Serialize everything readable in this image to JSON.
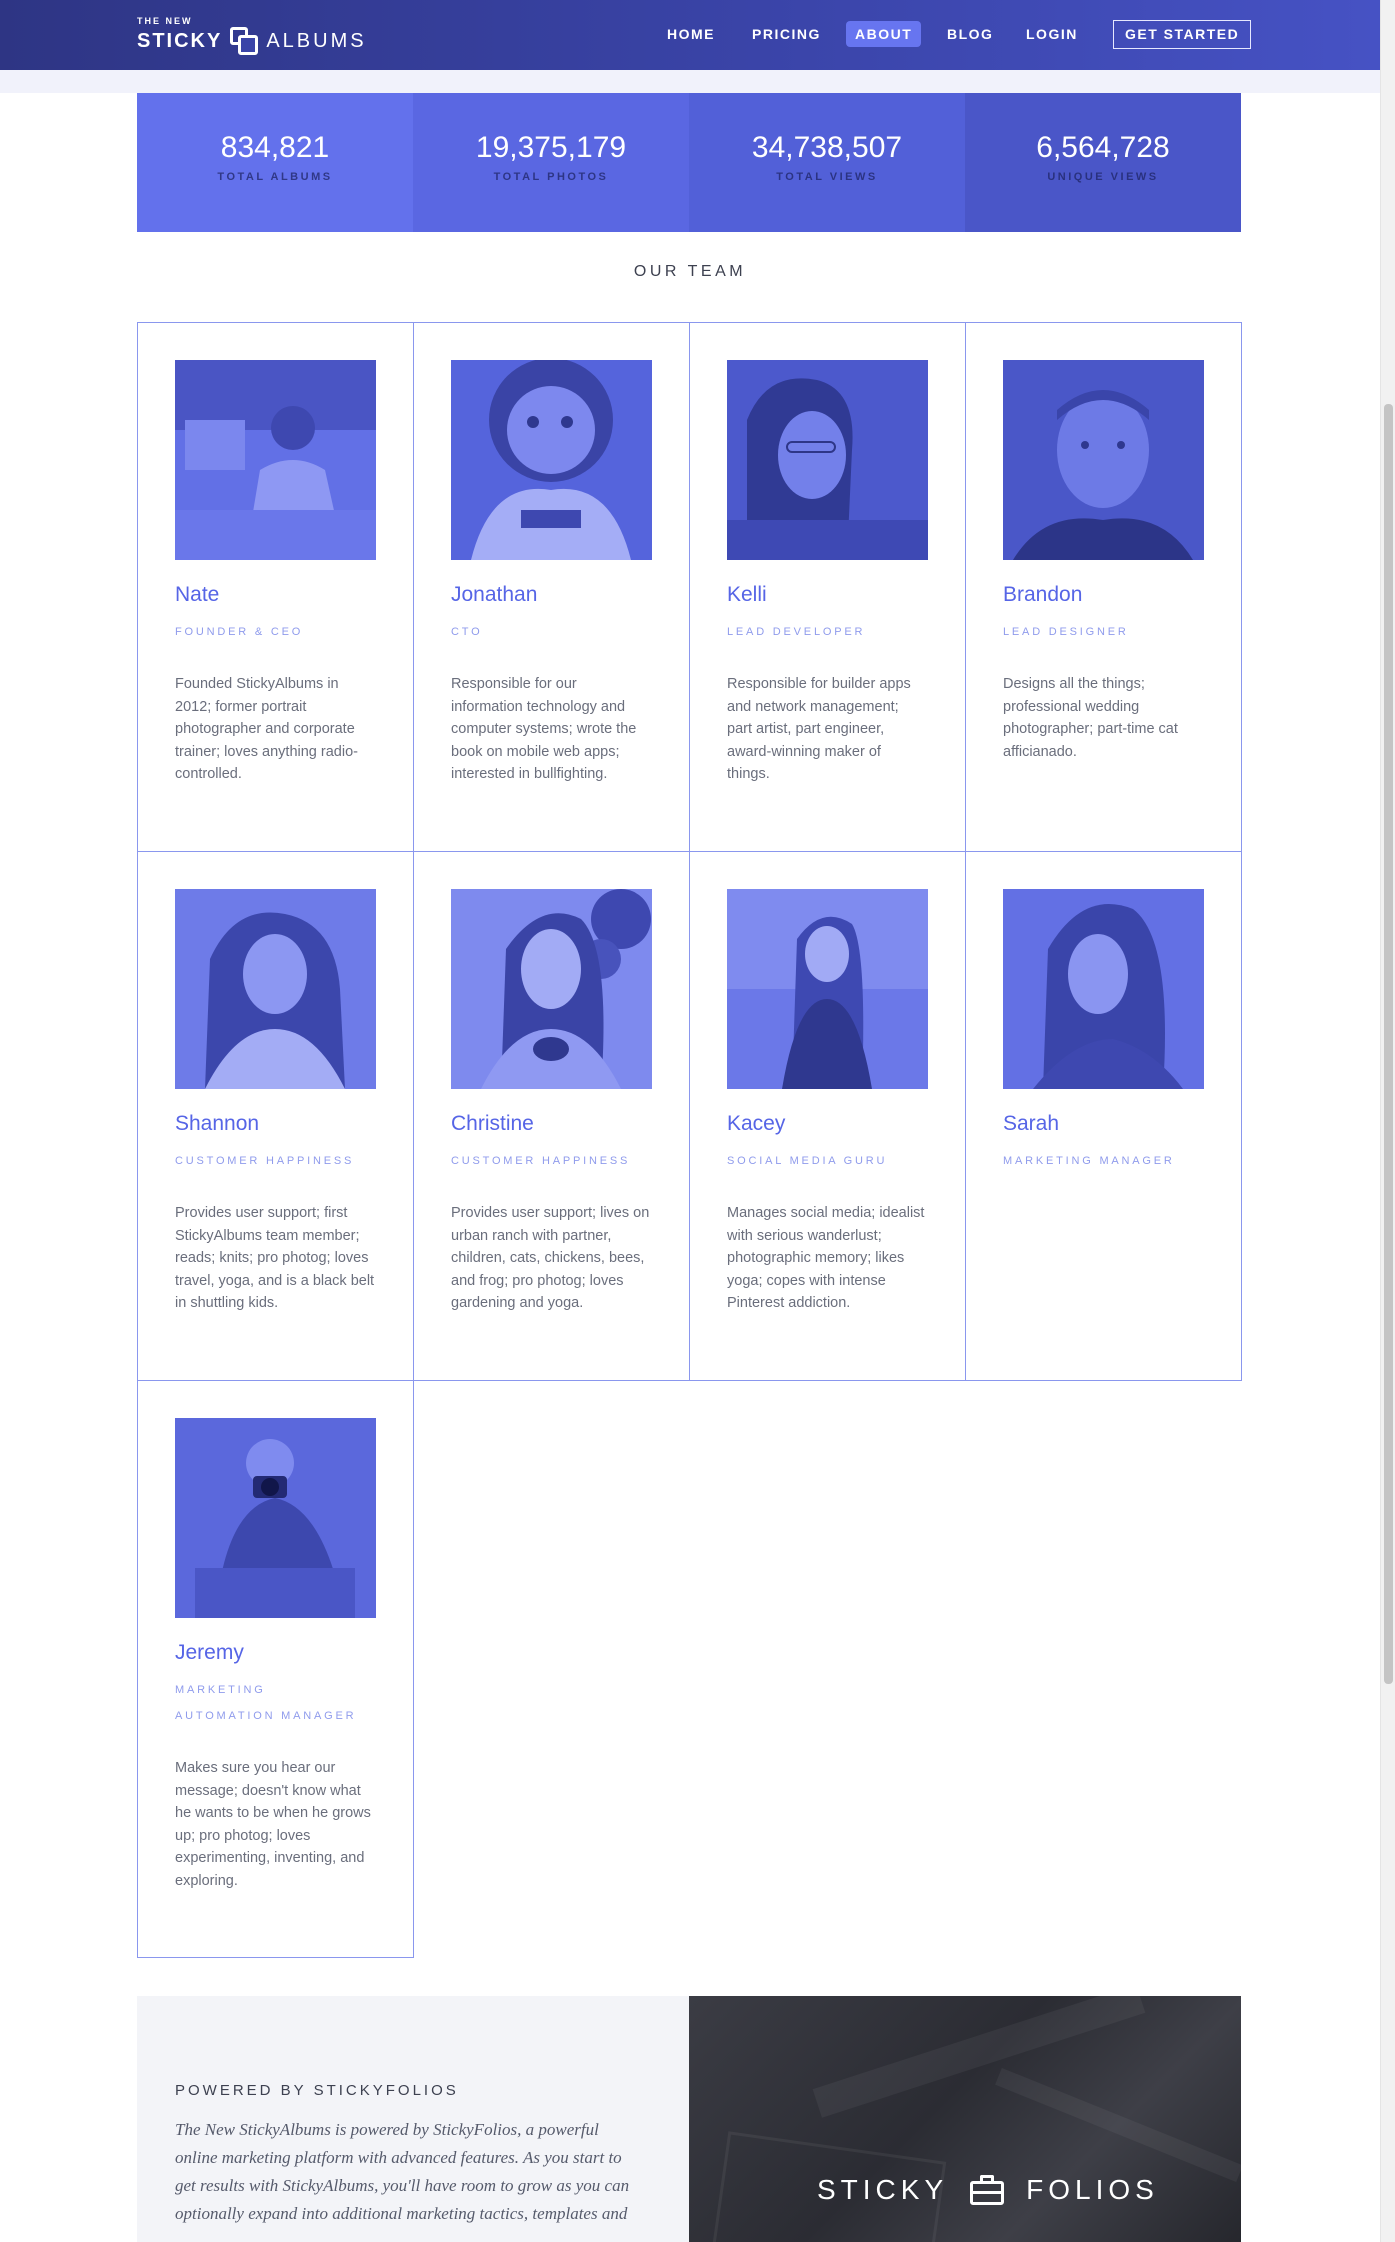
{
  "header": {
    "brand_small": "THE NEW",
    "brand_left": "STICKY",
    "brand_right": "ALBUMS",
    "nav": [
      {
        "label": "HOME",
        "active": false
      },
      {
        "label": "PRICING",
        "active": false
      },
      {
        "label": "ABOUT",
        "active": true
      },
      {
        "label": "BLOG",
        "active": false
      },
      {
        "label": "LOGIN",
        "active": false
      }
    ],
    "cta_label": "GET STARTED"
  },
  "stats": [
    {
      "value": "834,821",
      "label": "TOTAL ALBUMS"
    },
    {
      "value": "19,375,179",
      "label": "TOTAL PHOTOS"
    },
    {
      "value": "34,738,507",
      "label": "TOTAL VIEWS"
    },
    {
      "value": "6,564,728",
      "label": "UNIQUE VIEWS"
    }
  ],
  "team": {
    "title": "OUR TEAM",
    "members": [
      {
        "name": "Nate",
        "role": [
          "FOUNDER & CEO"
        ],
        "bio": [
          "Founded StickyAlbums in",
          "2012; former portrait",
          "photographer and corporate",
          "trainer; loves anything radio-",
          "controlled."
        ]
      },
      {
        "name": "Jonathan",
        "role": [
          "CTO"
        ],
        "bio": [
          "Responsible for our",
          "information technology and",
          "computer systems; wrote the",
          "book on mobile web apps;",
          "interested in bullfighting."
        ]
      },
      {
        "name": "Kelli",
        "role": [
          "LEAD DEVELOPER"
        ],
        "bio": [
          "Responsible for builder apps",
          "and network management;",
          "part artist, part engineer,",
          "award-winning maker of",
          "things."
        ]
      },
      {
        "name": "Brandon",
        "role": [
          "LEAD DESIGNER"
        ],
        "bio": [
          "Designs all the things;",
          "professional wedding",
          "photographer; part-time cat",
          "afficianado."
        ]
      },
      {
        "name": "Shannon",
        "role": [
          "CUSTOMER HAPPINESS"
        ],
        "bio": [
          "Provides user support; first",
          "StickyAlbums team member;",
          "reads; knits; pro photog; loves",
          "travel, yoga, and is a black belt",
          "in shuttling kids."
        ]
      },
      {
        "name": "Christine",
        "role": [
          "CUSTOMER HAPPINESS"
        ],
        "bio": [
          "Provides user support; lives on",
          "urban ranch with partner,",
          "children, cats, chickens, bees,",
          "and frog; pro photog; loves",
          "gardening and yoga."
        ]
      },
      {
        "name": "Kacey",
        "role": [
          "SOCIAL MEDIA GURU"
        ],
        "bio": [
          "Manages social media; idealist",
          "with serious wanderlust;",
          "photographic memory; likes",
          "yoga; copes with intense",
          "Pinterest addiction."
        ]
      },
      {
        "name": "Sarah",
        "role": [
          "MARKETING MANAGER"
        ],
        "bio": []
      },
      {
        "name": "Jeremy",
        "role": [
          "MARKETING",
          "AUTOMATION MANAGER"
        ],
        "bio": [
          "Makes sure you hear our",
          "message; doesn't know what",
          "he wants to be when he grows",
          "up; pro photog; loves",
          "experimenting, inventing, and",
          "exploring."
        ]
      }
    ]
  },
  "powered": {
    "title": "POWERED BY STICKYFOLIOS",
    "lines": [
      "The New StickyAlbums is powered by StickyFolios, a powerful",
      "online marketing platform with advanced features. As you start to",
      "get results with StickyAlbums, you'll have room to grow as you can",
      "optionally expand into additional marketing tactics, templates and"
    ]
  },
  "folios": {
    "left": "STICKY",
    "right": "FOLIOS",
    "icon": "briefcase-icon"
  },
  "colors": {
    "accent": "#5665e6",
    "nav_bg": "#3a44a8",
    "stat_1": "#6371ec",
    "stat_2": "#5a67e2",
    "stat_3": "#5260d8",
    "stat_4": "#4a56c8",
    "card_border": "#8a97ee"
  }
}
